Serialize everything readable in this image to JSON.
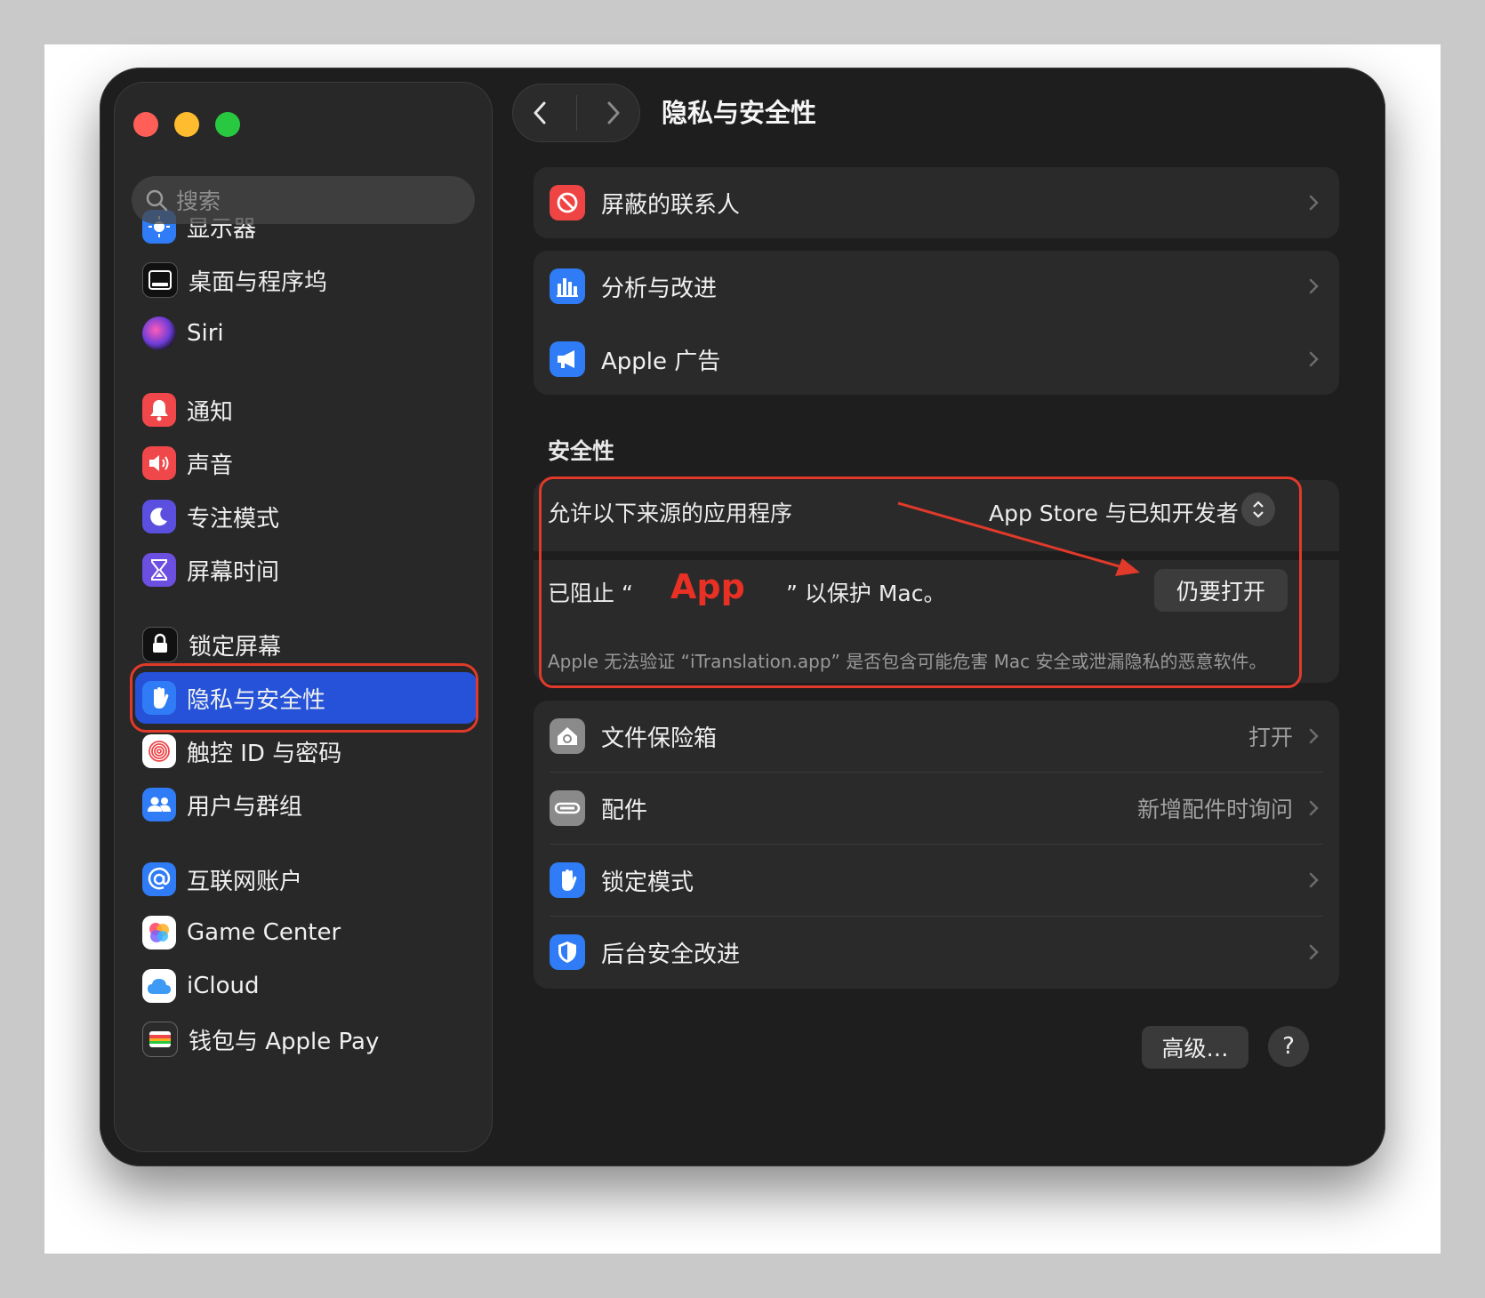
{
  "window": {
    "title": "隐私与安全性"
  },
  "search": {
    "placeholder": "搜索"
  },
  "sidebar": {
    "items": [
      {
        "label": "显示器",
        "icon": "display-icon",
        "color": "#2f7cf6"
      },
      {
        "label": "桌面与程序坞",
        "icon": "dock-icon",
        "color": "#111111"
      },
      {
        "label": "Siri",
        "icon": "siri-icon",
        "color": "#6c3cd8"
      },
      {
        "label": "通知",
        "icon": "bell-icon",
        "color": "#f0474a"
      },
      {
        "label": "声音",
        "icon": "speaker-icon",
        "color": "#f0474a"
      },
      {
        "label": "专注模式",
        "icon": "moon-icon",
        "color": "#5b4fe0"
      },
      {
        "label": "屏幕时间",
        "icon": "hourglass-icon",
        "color": "#6b4fe0"
      },
      {
        "label": "锁定屏幕",
        "icon": "lock-icon",
        "color": "#111111"
      },
      {
        "label": "隐私与安全性",
        "icon": "hand-icon",
        "color": "#2f7cf6"
      },
      {
        "label": "触控 ID 与密码",
        "icon": "fingerprint-icon",
        "color": "#ffffff"
      },
      {
        "label": "用户与群组",
        "icon": "users-icon",
        "color": "#2f7cf6"
      },
      {
        "label": "互联网账户",
        "icon": "at-icon",
        "color": "#2f7cf6"
      },
      {
        "label": "Game Center",
        "icon": "game-center-icon",
        "color": "#ffffff"
      },
      {
        "label": "iCloud",
        "icon": "cloud-icon",
        "color": "#ffffff"
      },
      {
        "label": "钱包与 Apple Pay",
        "icon": "wallet-icon",
        "color": "#2b2b2b"
      }
    ]
  },
  "main": {
    "blocked_contacts": {
      "label": "屏蔽的联系人",
      "icon": "blocked-icon",
      "color": "#ef4444"
    },
    "analytics": {
      "label": "分析与改进",
      "icon": "analytics-icon",
      "color": "#2f7cf6"
    },
    "apple_ads": {
      "label": "Apple 广告",
      "icon": "megaphone-icon",
      "color": "#2f7cf6"
    },
    "security": {
      "title": "安全性",
      "allow_label": "允许以下来源的应用程序",
      "allow_value": "App Store 与已知开发者",
      "blocked_prefix": "已阻止 “",
      "blocked_app": "App",
      "blocked_suffix": "” 以保护 Mac。",
      "open_anyway": "仍要打开",
      "warning": "Apple 无法验证 “iTranslation.app” 是否包含可能危害 Mac 安全或泄漏隐私的恶意软件。"
    },
    "filevault": {
      "label": "文件保险箱",
      "value": "打开",
      "icon": "vault-icon",
      "color": "#8a8a8a"
    },
    "accessories": {
      "label": "配件",
      "value": "新增配件时询问",
      "icon": "accessory-icon",
      "color": "#8a8a8a"
    },
    "lockdown": {
      "label": "锁定模式",
      "icon": "hand-icon",
      "color": "#2f7cf6"
    },
    "background_security": {
      "label": "后台安全改进",
      "icon": "shield-icon",
      "color": "#2f7cf6"
    },
    "advanced": "高级…",
    "help": "?"
  },
  "colors": {
    "accent": "#2552d8",
    "annotation": "#e23a2a"
  }
}
